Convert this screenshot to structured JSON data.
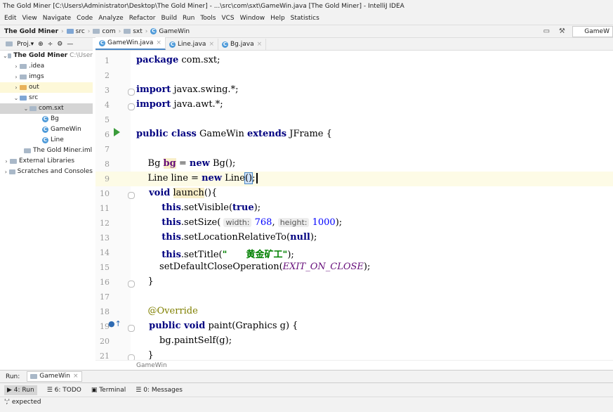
{
  "window": {
    "title": "The Gold Miner [C:\\Users\\Administrator\\Desktop\\The Gold Miner] - ...\\src\\com\\sxt\\GameWin.java [The Gold Miner] - IntelliJ IDEA"
  },
  "menu": [
    "Edit",
    "View",
    "Navigate",
    "Code",
    "Analyze",
    "Refactor",
    "Build",
    "Run",
    "Tools",
    "VCS",
    "Window",
    "Help",
    "Statistics"
  ],
  "breadcrumb": [
    "The Gold Miner",
    "src",
    "com",
    "sxt",
    "GameWin"
  ],
  "run_config": "GameW",
  "project_panel": {
    "label": "Proj.▾"
  },
  "tree": [
    {
      "label": "The Gold Miner",
      "suffix": "C:\\User",
      "indent": 0,
      "arrow": "⌄",
      "icon": "project"
    },
    {
      "label": ".idea",
      "indent": 1,
      "arrow": "›",
      "icon": "folder"
    },
    {
      "label": "imgs",
      "indent": 1,
      "arrow": "›",
      "icon": "folder"
    },
    {
      "label": "out",
      "indent": 1,
      "arrow": "›",
      "icon": "folder-orange"
    },
    {
      "label": "src",
      "indent": 1,
      "arrow": "⌄",
      "icon": "folder-blue"
    },
    {
      "label": "com.sxt",
      "indent": 2,
      "arrow": "⌄",
      "icon": "package"
    },
    {
      "label": "Bg",
      "indent": 3,
      "arrow": "",
      "icon": "class"
    },
    {
      "label": "GameWin",
      "indent": 3,
      "arrow": "",
      "icon": "class"
    },
    {
      "label": "Line",
      "indent": 3,
      "arrow": "",
      "icon": "class"
    },
    {
      "label": "The Gold Miner.iml",
      "indent": 2,
      "arrow": "",
      "icon": "iml"
    },
    {
      "label": "External Libraries",
      "indent": 0,
      "arrow": "›",
      "icon": "lib"
    },
    {
      "label": "Scratches and Consoles",
      "indent": 0,
      "arrow": "›",
      "icon": "scratch"
    }
  ],
  "tabs": [
    {
      "label": "GameWin.java",
      "active": true
    },
    {
      "label": "Line.java",
      "active": false
    },
    {
      "label": "Bg.java",
      "active": false
    }
  ],
  "code": {
    "line_numbers": [
      "1",
      "2",
      "3",
      "4",
      "5",
      "6",
      "7",
      "8",
      "9",
      "10",
      "11",
      "12",
      "13",
      "14",
      "15",
      "16",
      "17",
      "18",
      "19",
      "20",
      "21"
    ],
    "l1_kw": "package",
    "l1_rest": " com.sxt;",
    "l3_kw": "import",
    "l3_rest": " javax.swing.*;",
    "l4_kw": "import",
    "l4_rest": " java.awt.*;",
    "l6_kw1": "public class",
    "l6_mid": " GameWin ",
    "l6_kw2": "extends",
    "l6_rest": " JFrame {",
    "l8_a": "    Bg ",
    "l8_var": "bg",
    "l8_b": " = ",
    "l8_kw": "new",
    "l8_c": " Bg();",
    "l9_a": "    Line line = ",
    "l9_kw": "new",
    "l9_b": " Line",
    "l9_paren": "()",
    "l9_c": ";",
    "l10_kw": "    void",
    "l10_sp": " ",
    "l10_name": "launch",
    "l10_rest": "(){",
    "l11_kw": "        this",
    "l11_a": ".setVisible(",
    "l11_kw2": "true",
    "l11_b": ");",
    "l12_kw": "        this",
    "l12_a": ".setSize( ",
    "l12_h1": "width:",
    "l12_n1": " 768",
    "l12_c": ", ",
    "l12_h2": "height:",
    "l12_n2": " 1000",
    "l12_d": ");",
    "l13_kw": "        this",
    "l13_a": ".setLocationRelativeTo(",
    "l13_kw2": "null",
    "l13_b": ");",
    "l14_kw": "        this",
    "l14_a": ".setTitle(",
    "l14_str": "\"      黄金矿工\"",
    "l14_b": ");",
    "l15_a": "        setDefaultCloseOperation(",
    "l15_const": "EXIT_ON_CLOSE",
    "l15_b": ");",
    "l16": "    }",
    "l18": "    @Override",
    "l19_kw": "    public void",
    "l19_rest": " paint(Graphics g) {",
    "l20": "        bg.paintSelf(g);",
    "l21": "    }"
  },
  "editor_breadcrumb": "GameWin",
  "run": {
    "label": "Run:",
    "tab": "GameWin"
  },
  "toolwindows": [
    "4: Run",
    "6: TODO",
    "Terminal",
    "0: Messages"
  ],
  "status": "';' expected"
}
